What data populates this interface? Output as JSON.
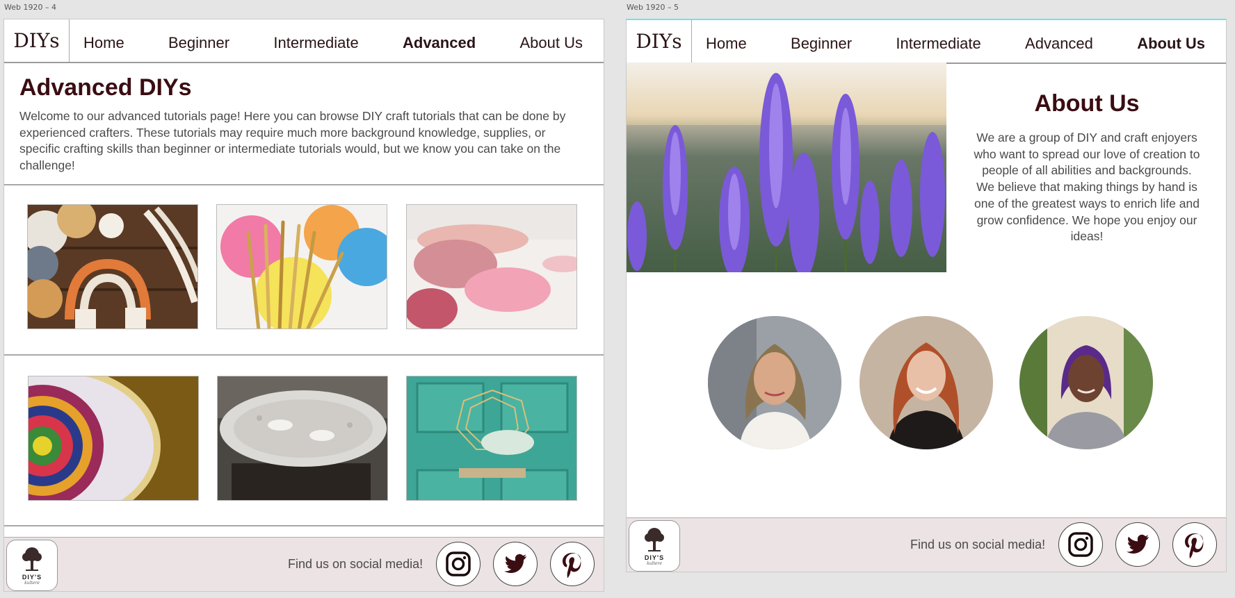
{
  "artboards": [
    {
      "label": "Web 1920 – 4",
      "nav": {
        "logo": "DIYs",
        "items": [
          "Home",
          "Beginner",
          "Intermediate",
          "Advanced",
          "About Us"
        ],
        "active": "Advanced"
      },
      "intro": {
        "title": "Advanced DIYs",
        "body": "Welcome to our advanced tutorials page! Here you can browse DIY craft tutorials that can be done by experienced crafters. These tutorials may require much more background knowledge, supplies, or specific crafting skills than beginner or intermediate tutorials would, but we know you can take on the challenge!"
      },
      "thumbnails": [
        {
          "name": "yarn-macrame-rainbow-image"
        },
        {
          "name": "knitting-needles-yarn-balls-image"
        },
        {
          "name": "pink-yarn-image"
        },
        {
          "name": "embroidery-hoop-image"
        },
        {
          "name": "lace-tablecloth-image"
        },
        {
          "name": "door-wreath-image"
        }
      ],
      "footer": {
        "logo_brand": "DIY'S",
        "logo_tag": "kultere",
        "social_text": "Find us on social media!",
        "social": [
          "instagram-icon",
          "twitter-icon",
          "pinterest-icon"
        ]
      }
    },
    {
      "label": "Web 1920 – 5",
      "nav": {
        "logo": "DIYs",
        "items": [
          "Home",
          "Beginner",
          "Intermediate",
          "Advanced",
          "About Us"
        ],
        "active": "About Us"
      },
      "about": {
        "title": "About Us",
        "body": "We are a group of DIY and craft enjoyers who want to spread our love of creation to people of all abilities and backgrounds. We believe that making things by hand is one of the greatest ways to enrich life and grow confidence. We hope you enjoy our ideas!"
      },
      "team": [
        "team-member-1",
        "team-member-2",
        "team-member-3"
      ],
      "footer": {
        "logo_brand": "DIY'S",
        "logo_tag": "kultere",
        "social_text": "Find us on social media!",
        "social": [
          "instagram-icon",
          "twitter-icon",
          "pinterest-icon"
        ]
      }
    }
  ],
  "colors": {
    "accent_dark": "#3a0d12",
    "footer_bg": "#ece3e4",
    "selection_border": "#6ee3ee"
  }
}
